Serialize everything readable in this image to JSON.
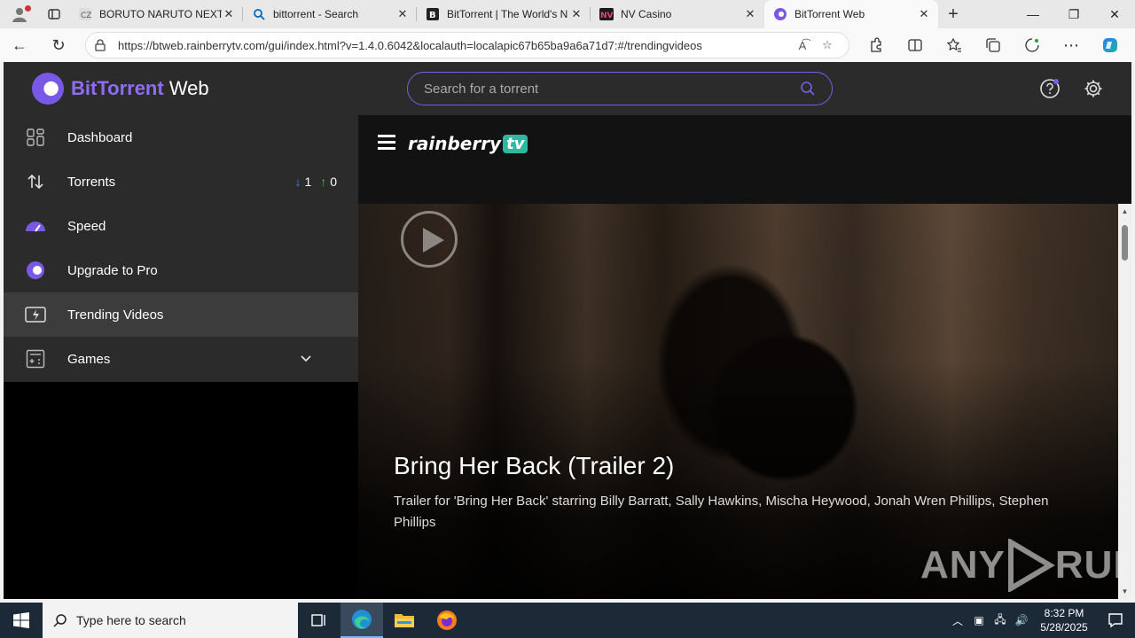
{
  "browser": {
    "tabs": [
      {
        "title": "BORUTO NARUTO NEXT G",
        "favicon": "crunchyroll-icon"
      },
      {
        "title": "bittorrent - Search",
        "favicon": "search-icon"
      },
      {
        "title": "BitTorrent | The World's N",
        "favicon": "bittorrent-b-icon"
      },
      {
        "title": "NV Casino",
        "favicon": "nv-casino-icon"
      },
      {
        "title": "BitTorrent Web",
        "favicon": "bittorrent-web-icon"
      }
    ],
    "url": "https://btweb.rainberrytv.com/gui/index.html?v=1.4.0.6042&localauth=localapic67b65ba9a6a71d7:#/trendingvideos"
  },
  "app": {
    "logo_bold": "BitTorrent",
    "logo_rest": " Web",
    "search_placeholder": "Search for a torrent",
    "sidebar": {
      "items": [
        {
          "label": "Dashboard",
          "icon": "dashboard-icon"
        },
        {
          "label": "Torrents",
          "icon": "torrents-icon",
          "down": "1",
          "up": "0"
        },
        {
          "label": "Speed",
          "icon": "speed-icon"
        },
        {
          "label": "Upgrade to Pro",
          "icon": "pro-icon"
        },
        {
          "label": "Trending Videos",
          "icon": "trending-videos-icon"
        },
        {
          "label": "Games",
          "icon": "games-icon"
        }
      ]
    },
    "rainberry": {
      "brand": "rainberry",
      "tv": "tv"
    },
    "video": {
      "title": "Bring Her Back (Trailer 2)",
      "description": "Trailer for 'Bring Her Back' starring Billy Barratt, Sally Hawkins, Mischa Heywood, Jonah Wren Phillips, Stephen Phillips"
    },
    "watermark": "ANY RUN"
  },
  "taskbar": {
    "search_placeholder": "Type here to search",
    "time": "8:32 PM",
    "date": "5/28/2025"
  },
  "colors": {
    "accent": "#7a5ce8",
    "rainberry_tv": "#2fb7a0",
    "down": "#3b82f6",
    "up": "#22c55e"
  }
}
